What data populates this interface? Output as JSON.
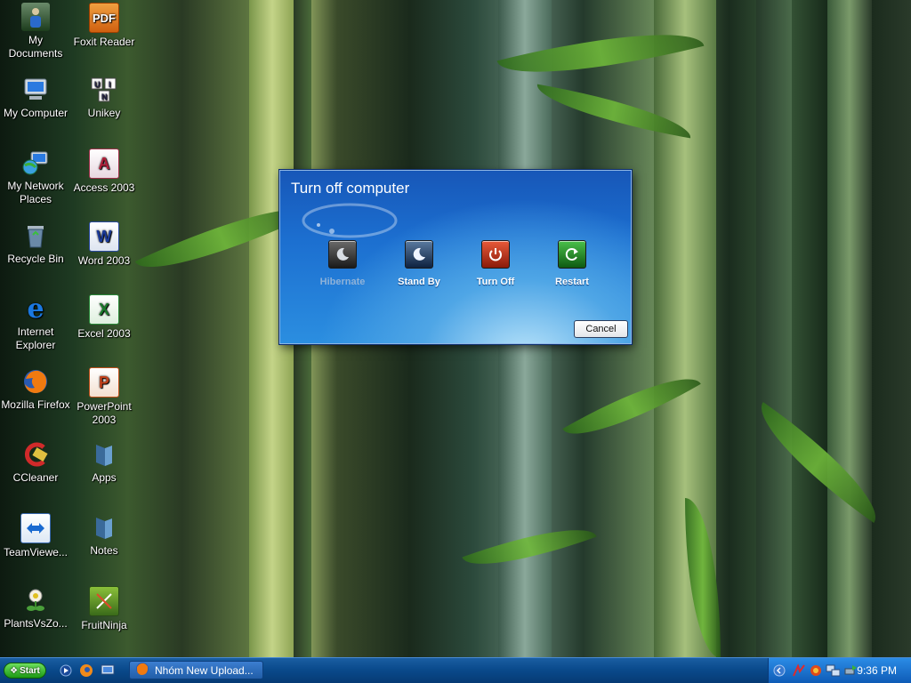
{
  "desktop_icons": [
    {
      "label": "My Documents"
    },
    {
      "label": "Foxit Reader"
    },
    {
      "label": "My Computer"
    },
    {
      "label": "Unikey"
    },
    {
      "label": "My Network Places"
    },
    {
      "label": "Access 2003"
    },
    {
      "label": "Recycle Bin"
    },
    {
      "label": "Word 2003"
    },
    {
      "label": "Internet Explorer"
    },
    {
      "label": "Excel 2003"
    },
    {
      "label": "Mozilla Firefox"
    },
    {
      "label": "PowerPoint 2003"
    },
    {
      "label": "CCleaner"
    },
    {
      "label": "Apps"
    },
    {
      "label": "TeamViewe..."
    },
    {
      "label": "Notes"
    },
    {
      "label": "PlantsVsZo..."
    },
    {
      "label": "FruitNinja"
    }
  ],
  "dialog": {
    "title": "Turn off computer",
    "options": [
      {
        "label": "Hibernate",
        "enabled": false
      },
      {
        "label": "Stand By",
        "enabled": true
      },
      {
        "label": "Turn Off",
        "enabled": true
      },
      {
        "label": "Restart",
        "enabled": true
      }
    ],
    "cancel_label": "Cancel"
  },
  "taskbar": {
    "start_label": "Start",
    "task_label": "Nhóm New Upload...",
    "clock": "9:36 PM"
  }
}
